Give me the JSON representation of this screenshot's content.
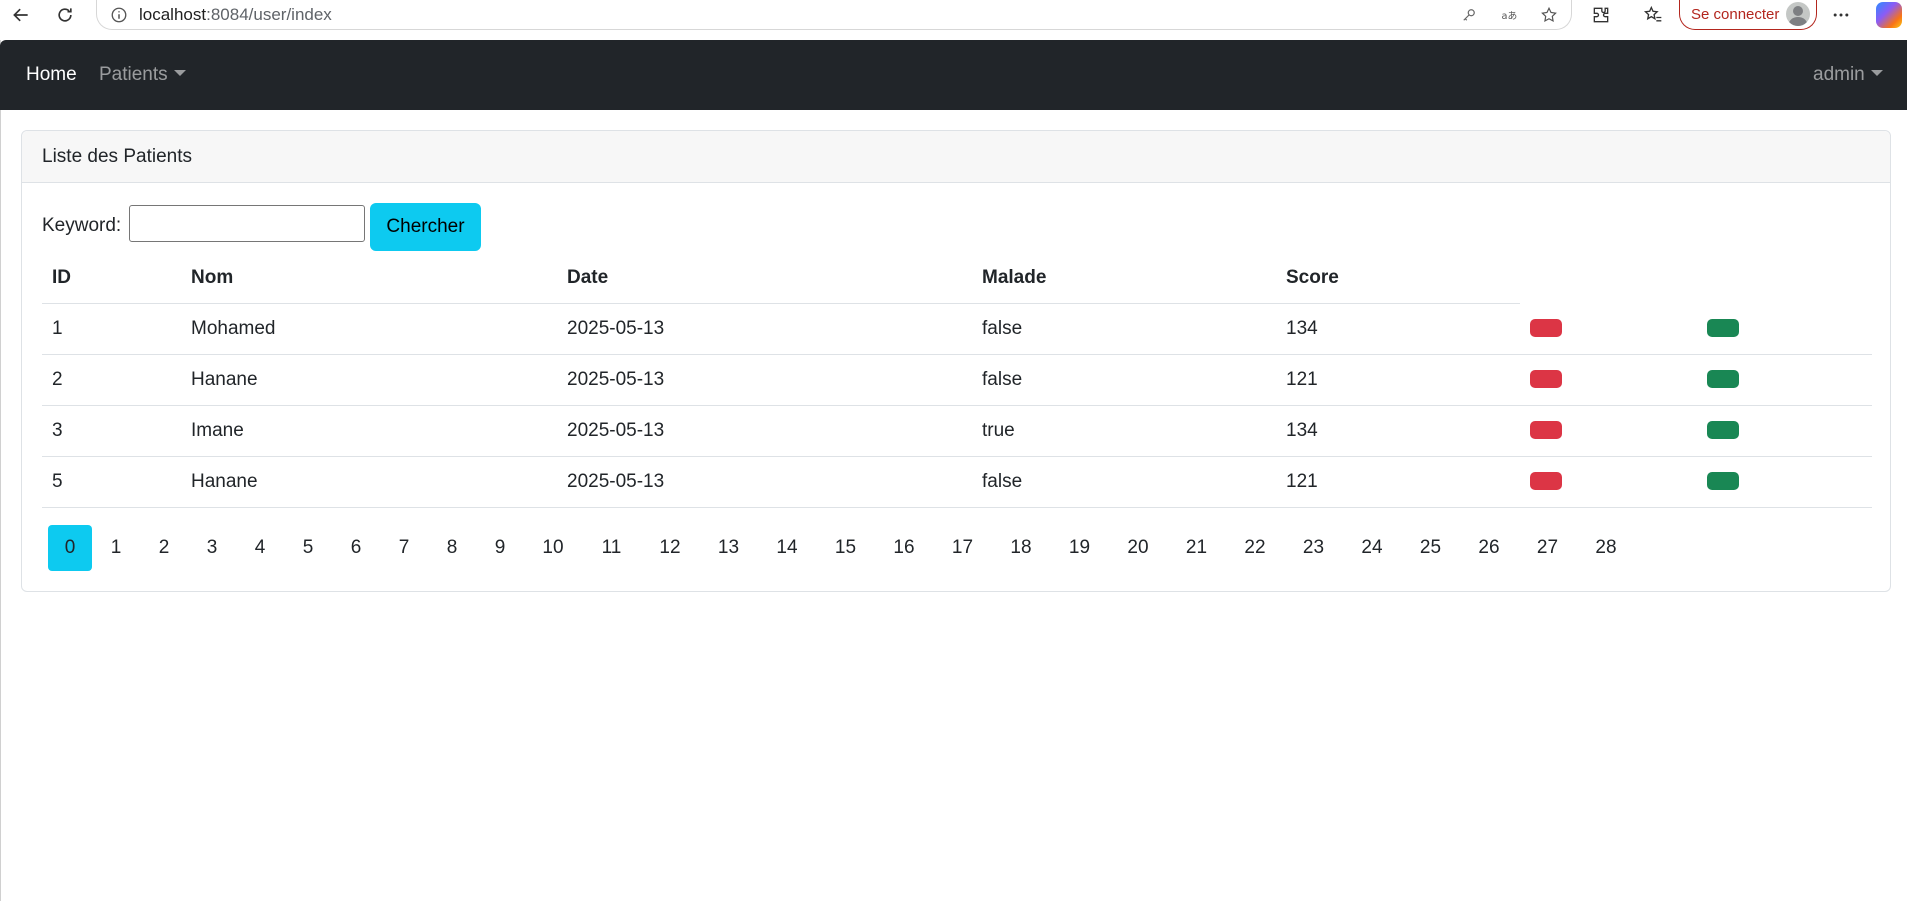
{
  "browser": {
    "url_host": "localhost",
    "url_path": ":8084/user/index",
    "signin_label": "Se connecter"
  },
  "navbar": {
    "home": "Home",
    "patients": "Patients",
    "user": "admin"
  },
  "card": {
    "title": "Liste des Patients"
  },
  "search": {
    "label": "Keyword:",
    "value": "",
    "button": "Chercher"
  },
  "table": {
    "headers": [
      "ID",
      "Nom",
      "Date",
      "Malade",
      "Score"
    ],
    "rows": [
      {
        "id": "1",
        "nom": "Mohamed",
        "date": "2025-05-13",
        "malade": "false",
        "score": "134"
      },
      {
        "id": "2",
        "nom": "Hanane",
        "date": "2025-05-13",
        "malade": "false",
        "score": "121"
      },
      {
        "id": "3",
        "nom": "Imane",
        "date": "2025-05-13",
        "malade": "true",
        "score": "134"
      },
      {
        "id": "5",
        "nom": "Hanane",
        "date": "2025-05-13",
        "malade": "false",
        "score": "121"
      }
    ]
  },
  "pagination": {
    "active": "0",
    "pages": [
      "0",
      "1",
      "2",
      "3",
      "4",
      "5",
      "6",
      "7",
      "8",
      "9",
      "10",
      "11",
      "12",
      "13",
      "14",
      "15",
      "16",
      "17",
      "18",
      "19",
      "20",
      "21",
      "22",
      "23",
      "24",
      "25",
      "26",
      "27",
      "28"
    ]
  },
  "colors": {
    "navbar": "#212529",
    "info": "#0dcaf0",
    "danger": "#dc3545",
    "success": "#198754"
  }
}
